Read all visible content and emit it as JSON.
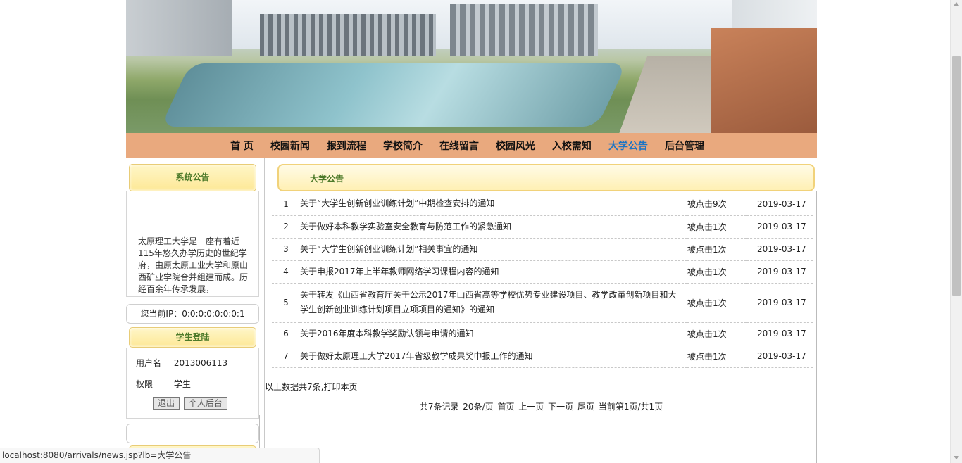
{
  "nav": {
    "items": [
      "首 页",
      "校园新闻",
      "报到流程",
      "学校简介",
      "在线留言",
      "校园风光",
      "入校需知",
      "大学公告",
      "后台管理"
    ],
    "active": "大学公告"
  },
  "sidebar": {
    "notice_title": "系统公告",
    "notice_text": "太原理工大学是一座有着近115年悠久办学历史的世纪学府，由原太原工业大学和原山西矿业学院合并组建而成。历经百余年传承发展，",
    "ip_label": "您当前IP：0:0:0:0:0:0:0:1",
    "login_title": "学生登陆",
    "username_label": "用户名",
    "username_value": "2013006113",
    "role_label": "权限",
    "role_value": "学生",
    "logout_button": "退出",
    "personal_button": "个人后台"
  },
  "main": {
    "title": "大学公告",
    "rows": [
      {
        "num": "1",
        "title": "关于“大学生创新创业训练计划”中期检查安排的通知",
        "clicks": "被点击9次",
        "date": "2019-03-17"
      },
      {
        "num": "2",
        "title": "关于做好本科教学实验室安全教育与防范工作的紧急通知",
        "clicks": "被点击1次",
        "date": "2019-03-17"
      },
      {
        "num": "3",
        "title": "关于“大学生创新创业训练计划”相关事宜的通知",
        "clicks": "被点击1次",
        "date": "2019-03-17"
      },
      {
        "num": "4",
        "title": "关于申报2017年上半年教师网络学习课程内容的通知",
        "clicks": "被点击1次",
        "date": "2019-03-17"
      },
      {
        "num": "5",
        "title": "关于转发《山西省教育厅关于公示2017年山西省高等学校优势专业建设项目、教学改革创新项目和大学生创新创业训练计划项目立项项目的通知》的通知",
        "clicks": "被点击1次",
        "date": "2019-03-17"
      },
      {
        "num": "6",
        "title": "关于2016年度本科教学奖励认领与申请的通知",
        "clicks": "被点击1次",
        "date": "2019-03-17"
      },
      {
        "num": "7",
        "title": "关于做好太原理工大学2017年省级教学成果奖申报工作的通知",
        "clicks": "被点击1次",
        "date": "2019-03-17"
      }
    ],
    "summary_prefix": "以上数据共7条,",
    "print_link": "打印本页",
    "pager": {
      "total": "共7条记录",
      "per_page": "20条/页",
      "first": "首页",
      "prev": "上一页",
      "next": "下一页",
      "last": "尾页",
      "current": "当前第1页/共1页"
    }
  },
  "status_bar": {
    "url": "localhost:8080/arrivals/news.jsp?lb=大学公告"
  },
  "colors": {
    "nav_bg": "#e9a97e",
    "active_nav": "#1b74c5",
    "header_text": "#4d7a2a"
  }
}
